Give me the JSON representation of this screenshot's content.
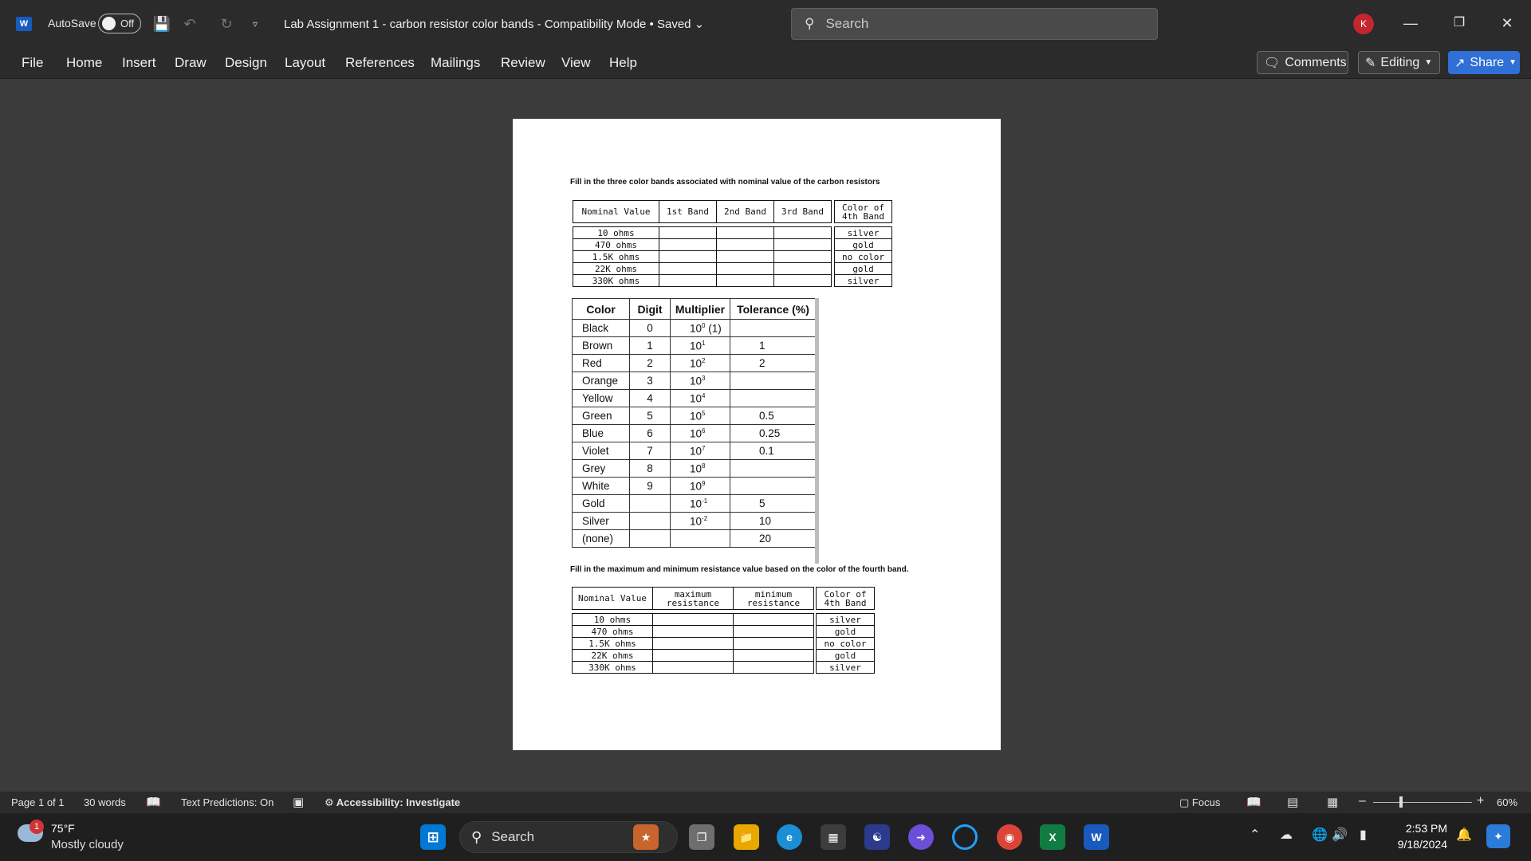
{
  "titlebar": {
    "app_logo": "W",
    "autosave_label": "AutoSave",
    "autosave_state": "Off",
    "doc_title": "Lab Assignment 1 - carbon resistor color bands  -  Compatibility Mode • Saved",
    "search_placeholder": "Search",
    "avatar_initial": "K",
    "icons": {
      "save": "save-icon",
      "undo": "undo-icon",
      "redo": "redo-icon",
      "customize": "customize-icon",
      "minimize": "minimize-icon",
      "restore": "restore-icon",
      "close": "close-icon"
    }
  },
  "ribbon": {
    "tabs": [
      "File",
      "Home",
      "Insert",
      "Draw",
      "Design",
      "Layout",
      "References",
      "Mailings",
      "Review",
      "View",
      "Help"
    ],
    "comments_label": "Comments",
    "editing_label": "Editing",
    "share_label": "Share"
  },
  "document": {
    "instruction1": "Fill in the three color bands associated with nominal value of the carbon resistors",
    "instruction2": "Fill in the maximum and minimum resistance value based on the color of the fourth band.",
    "table1": {
      "headers": [
        "Nominal Value",
        "1st Band",
        "2nd Band",
        "3rd Band"
      ],
      "fourth_header": [
        "Color of",
        "4th Band"
      ],
      "rows": [
        "10 ohms",
        "470 ohms",
        "1.5K ohms",
        "22K ohms",
        "330K ohms"
      ],
      "fourth_band": [
        "silver",
        "gold",
        "no color",
        "gold",
        "silver"
      ]
    },
    "color_table": {
      "headers": [
        "Color",
        "Digit",
        "Multiplier",
        "Tolerance (%)"
      ],
      "rows": [
        {
          "color": "Black",
          "digit": "0",
          "base": "10",
          "exp": "0",
          "suffix": " (1)",
          "tol": ""
        },
        {
          "color": "Brown",
          "digit": "1",
          "base": "10",
          "exp": "1",
          "suffix": "",
          "tol": "1"
        },
        {
          "color": "Red",
          "digit": "2",
          "base": "10",
          "exp": "2",
          "suffix": "",
          "tol": "2"
        },
        {
          "color": "Orange",
          "digit": "3",
          "base": "10",
          "exp": "3",
          "suffix": "",
          "tol": ""
        },
        {
          "color": "Yellow",
          "digit": "4",
          "base": "10",
          "exp": "4",
          "suffix": "",
          "tol": ""
        },
        {
          "color": "Green",
          "digit": "5",
          "base": "10",
          "exp": "5",
          "suffix": "",
          "tol": "0.5"
        },
        {
          "color": "Blue",
          "digit": "6",
          "base": "10",
          "exp": "6",
          "suffix": "",
          "tol": "0.25"
        },
        {
          "color": "Violet",
          "digit": "7",
          "base": "10",
          "exp": "7",
          "suffix": "",
          "tol": "0.1"
        },
        {
          "color": "Grey",
          "digit": "8",
          "base": "10",
          "exp": "8",
          "suffix": "",
          "tol": ""
        },
        {
          "color": "White",
          "digit": "9",
          "base": "10",
          "exp": "9",
          "suffix": "",
          "tol": ""
        },
        {
          "color": "Gold",
          "digit": "",
          "base": "10",
          "exp": "-1",
          "suffix": "",
          "tol": "5"
        },
        {
          "color": "Silver",
          "digit": "",
          "base": "10",
          "exp": "-2",
          "suffix": "",
          "tol": "10"
        },
        {
          "color": "(none)",
          "digit": "",
          "base": "",
          "exp": "",
          "suffix": "",
          "tol": "20"
        }
      ]
    },
    "table2": {
      "headers": [
        "Nominal Value",
        "maximum resistance",
        "minimum resistance"
      ],
      "fourth_header": [
        "Color of",
        "4th Band"
      ],
      "rows": [
        "10 ohms",
        "470 ohms",
        "1.5K ohms",
        "22K ohms",
        "330K ohms"
      ],
      "fourth_band": [
        "silver",
        "gold",
        "no color",
        "gold",
        "silver"
      ]
    }
  },
  "statusbar": {
    "page": "Page 1 of 1",
    "words": "30 words",
    "text_predictions": "Text Predictions: On",
    "accessibility": "Accessibility: Investigate",
    "focus": "Focus",
    "zoom": "60%"
  },
  "taskbar": {
    "weather_badge": "1",
    "temperature": "75°F",
    "condition": "Mostly cloudy",
    "search_placeholder": "Search",
    "time": "2:53 PM",
    "date": "9/18/2024"
  },
  "colors": {
    "accent": "#2f6fd6",
    "word_blue": "#185abd",
    "avatar": "#c4262e",
    "page_bg": "#ffffff",
    "canvas_bg": "#3b3b3b"
  }
}
